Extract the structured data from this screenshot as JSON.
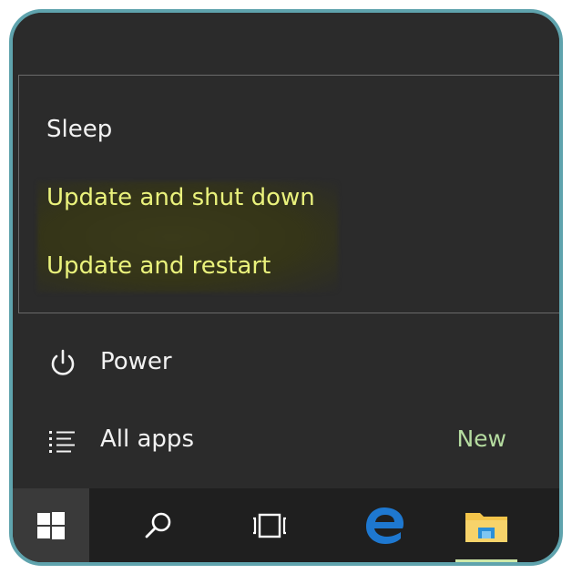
{
  "power_menu": {
    "options": [
      {
        "label": "Sleep"
      },
      {
        "label": "Update and shut down"
      },
      {
        "label": "Update and restart"
      }
    ]
  },
  "start_menu": {
    "power_label": "Power",
    "all_apps_label": "All apps",
    "new_badge": "New"
  },
  "taskbar": {
    "buttons": [
      {
        "icon": "windows-logo-icon"
      },
      {
        "icon": "search-icon"
      },
      {
        "icon": "task-view-icon"
      },
      {
        "icon": "edge-browser-icon"
      },
      {
        "icon": "file-explorer-icon"
      }
    ]
  },
  "colors": {
    "frame_border": "#5fa3ad",
    "menu_background": "#2b2b2b",
    "taskbar_background": "#1f1f1f",
    "highlight_text": "#eaf27c",
    "new_badge": "#b5dca0",
    "edge_blue": "#1e78d0",
    "folder_yellow": "#f3c44a"
  }
}
